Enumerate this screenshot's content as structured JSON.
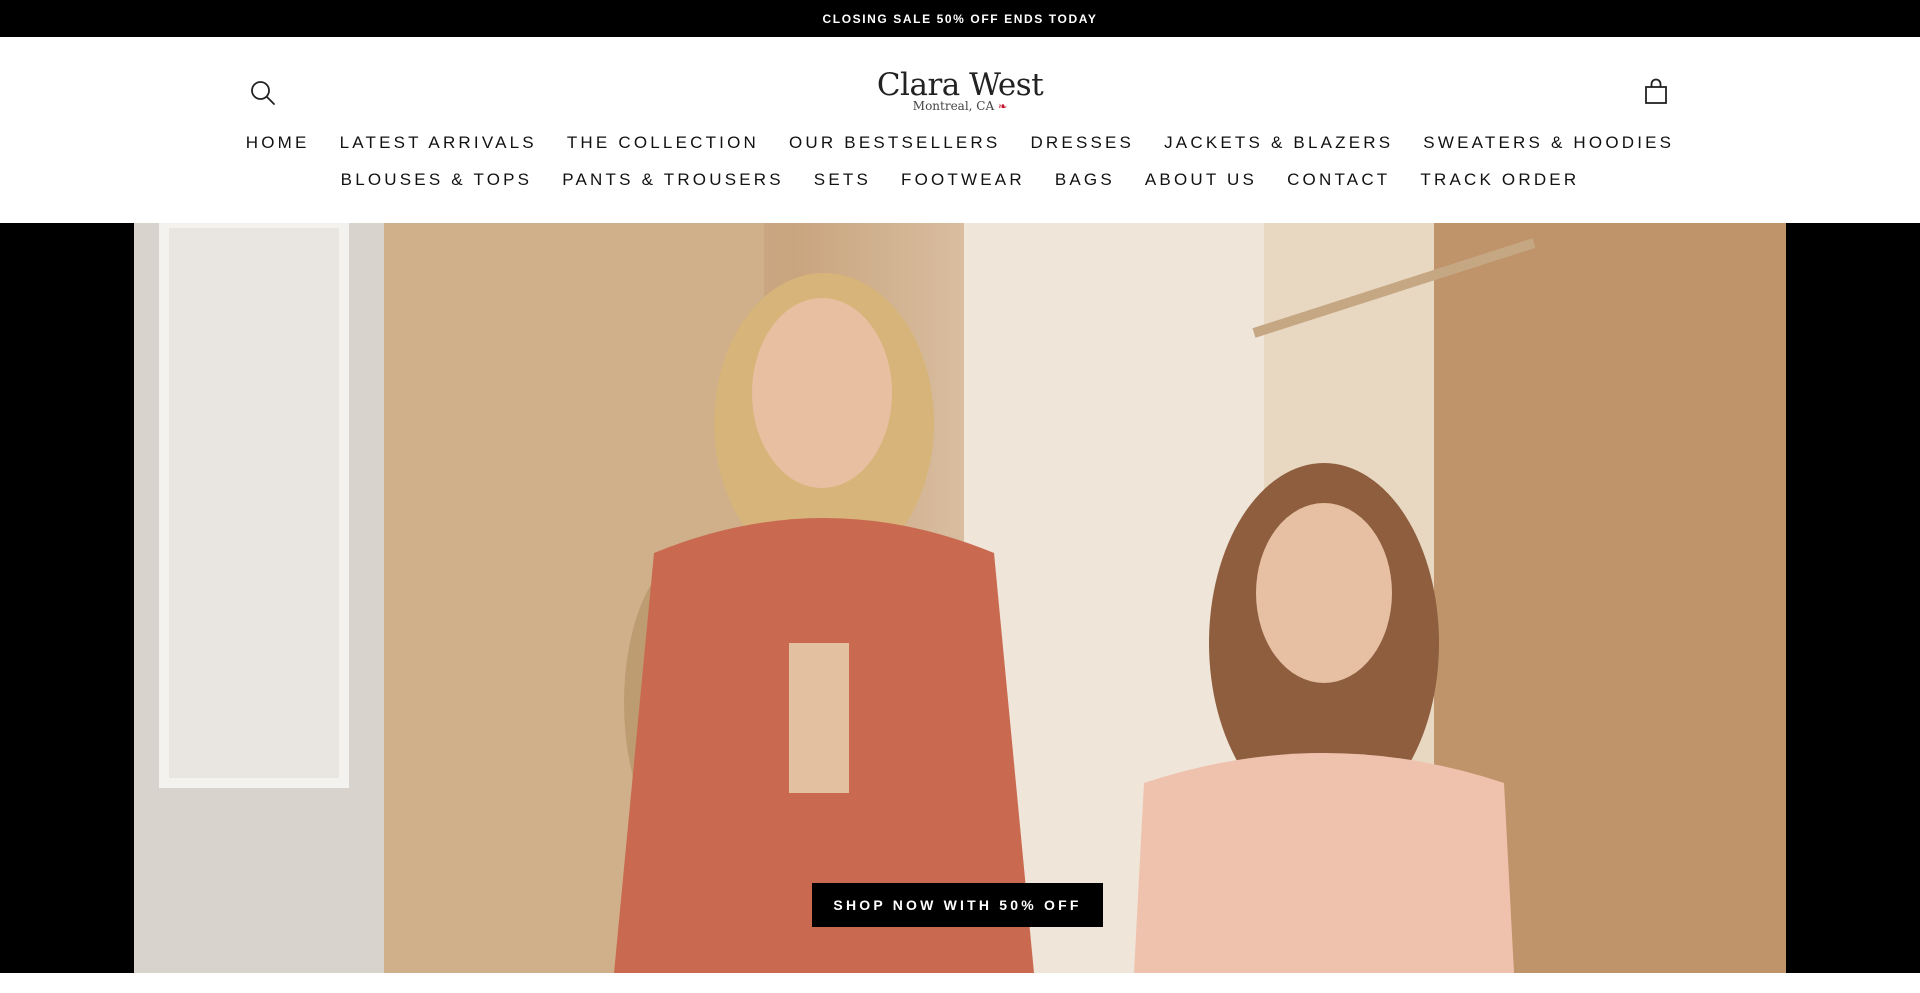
{
  "announcement": {
    "text": "CLOSING SALE 50% OFF ENDS TODAY"
  },
  "header": {
    "logo": {
      "name": "Clara West",
      "location": "Montreal, CA",
      "flag_icon": "maple-leaf-icon"
    },
    "search_icon": "search-icon",
    "cart_icon": "shopping-bag-icon"
  },
  "nav": {
    "row1": [
      "HOME",
      "LATEST ARRIVALS",
      "THE COLLECTION",
      "OUR BESTSELLERS",
      "DRESSES",
      "JACKETS & BLAZERS",
      "SWEATERS & HOODIES"
    ],
    "row2": [
      "BLOUSES & TOPS",
      "PANTS & TROUSERS",
      "SETS",
      "FOOTWEAR",
      "BAGS",
      "ABOUT US",
      "CONTACT",
      "TRACK ORDER"
    ]
  },
  "hero": {
    "cta_label": "SHOP NOW WITH 50% OFF"
  },
  "colors": {
    "announcement_bg": "#000000",
    "cta_bg": "#000000",
    "shirt_rust": "#c96a50",
    "dress_blush": "#efc2ae",
    "maple_red": "#c8102e"
  }
}
